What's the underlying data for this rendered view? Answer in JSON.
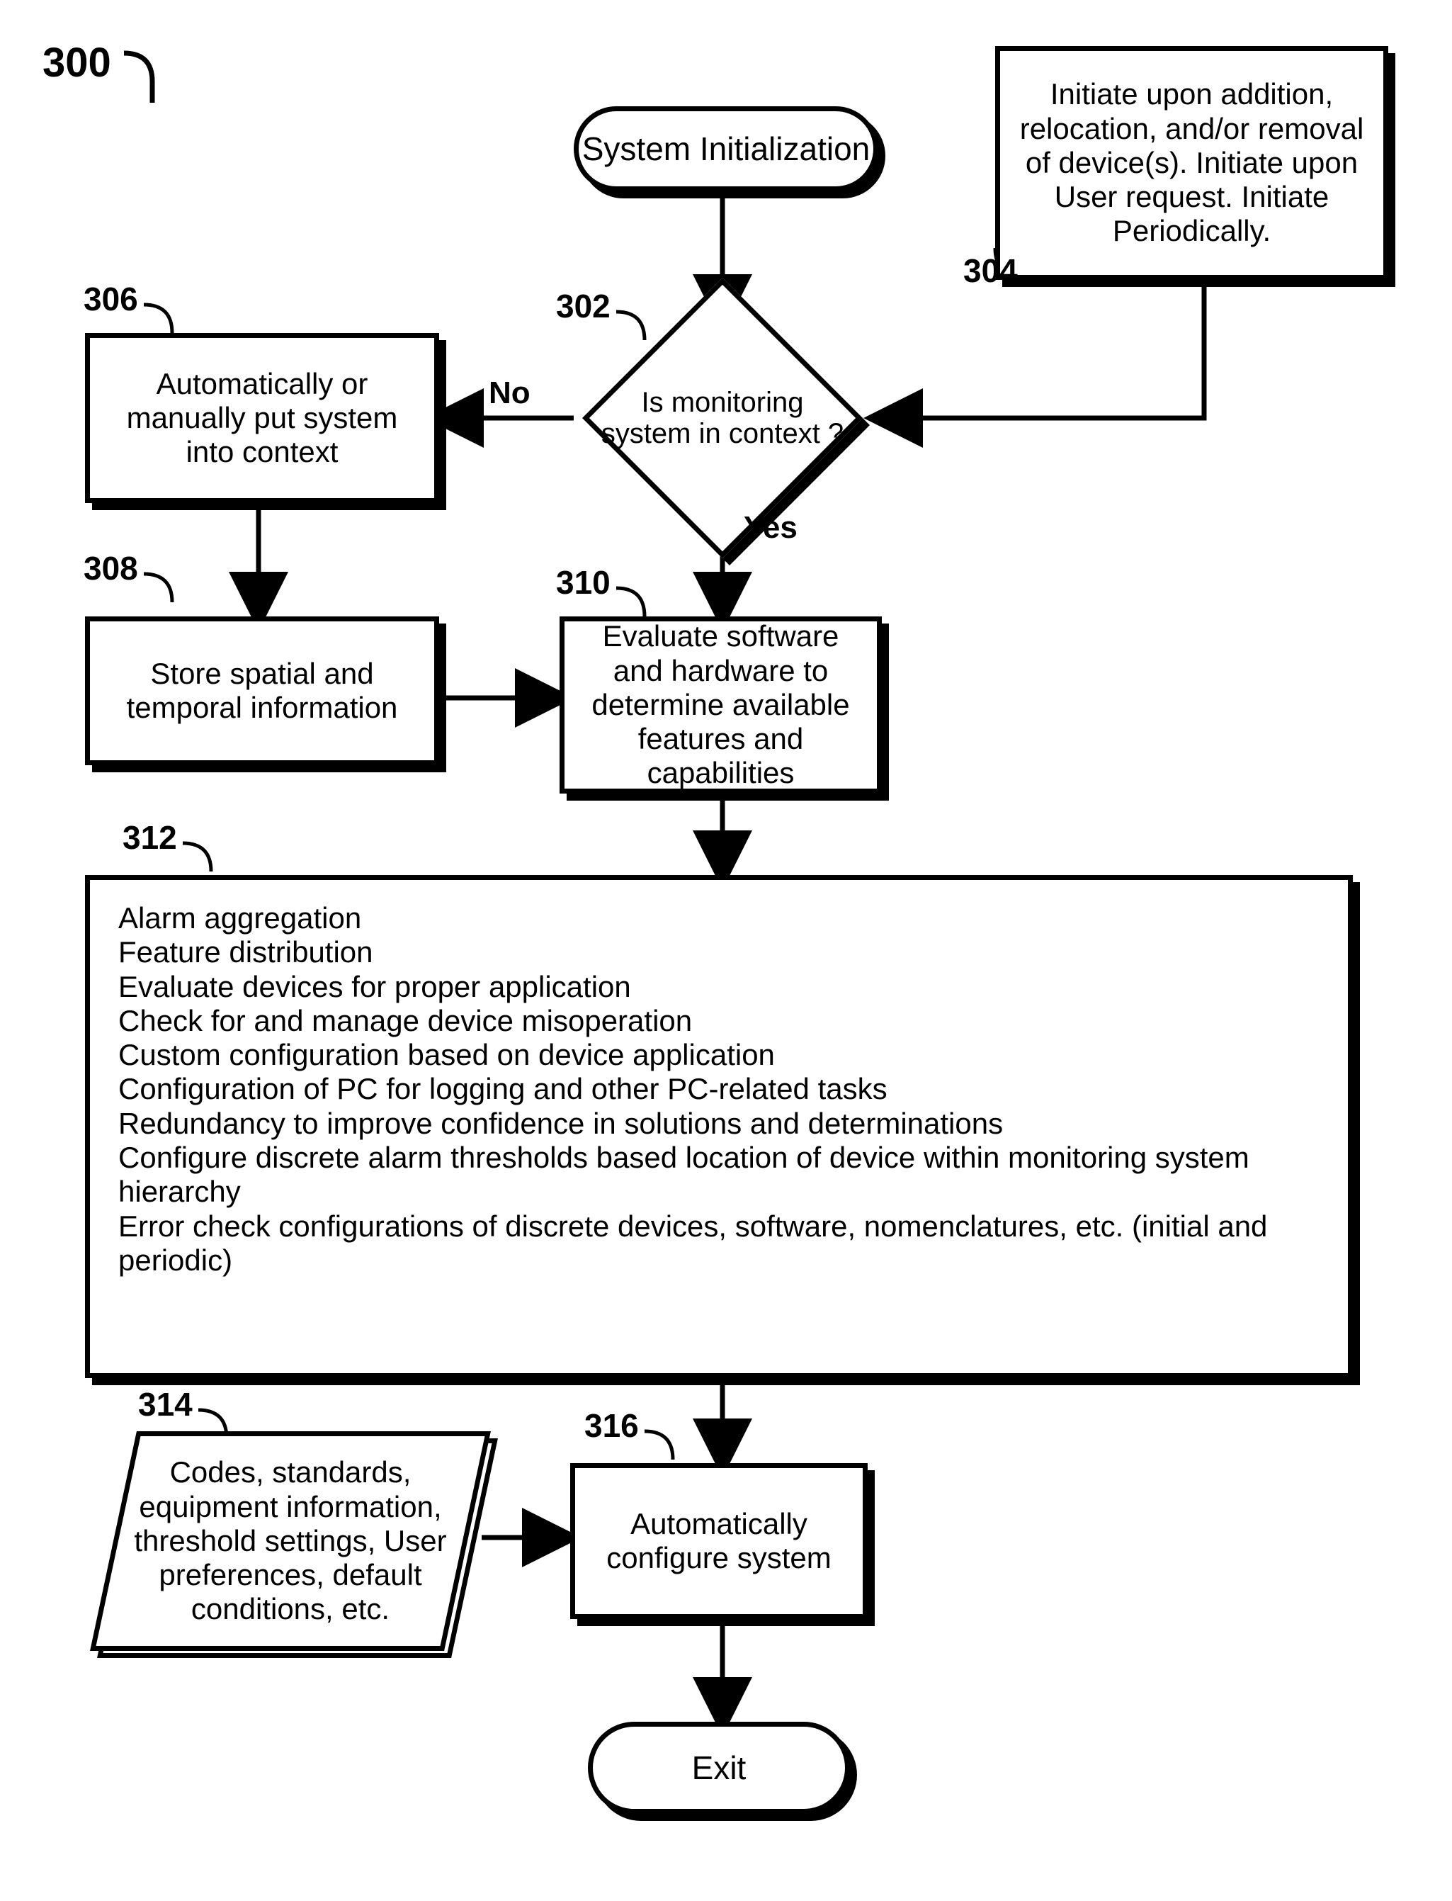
{
  "figure_ref": "300",
  "nodes": {
    "start": "System Initialization",
    "n304": "Initiate upon addition, relocation, and/or removal of device(s). Initiate upon User request. Initiate Periodically.",
    "n302": "Is monitoring system in context ?",
    "n306": "Automatically or manually put system into context",
    "n308": "Store spatial and temporal information",
    "n310": "Evaluate software and hardware to determine available features and capabilities",
    "n312_lines": [
      "Alarm aggregation",
      "Feature distribution",
      "Evaluate devices for proper application",
      "Check for and manage device misoperation",
      "Custom configuration based on device application",
      "Configuration of PC for logging and other PC-related tasks",
      "Redundancy to improve confidence in solutions and determinations",
      "Configure discrete alarm thresholds based location of device within monitoring system hierarchy",
      "Error check configurations of discrete devices, software, nomenclatures, etc. (initial and periodic)"
    ],
    "n314": "Codes, standards, equipment information, threshold settings, User preferences, default conditions, etc.",
    "n316": "Automatically configure system",
    "exit": "Exit"
  },
  "edges": {
    "no": "No",
    "yes": "Yes"
  },
  "refs": {
    "r302": "302",
    "r304": "304",
    "r306": "306",
    "r308": "308",
    "r310": "310",
    "r312": "312",
    "r314": "314",
    "r316": "316"
  }
}
